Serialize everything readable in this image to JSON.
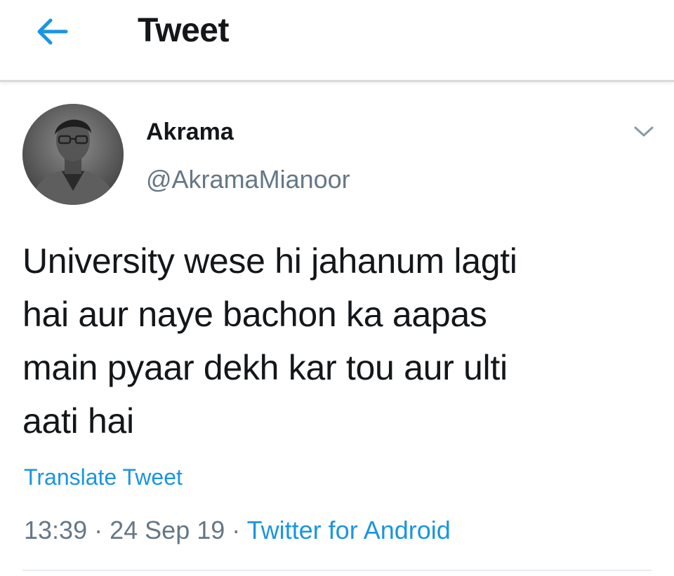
{
  "header": {
    "back_icon": "arrow-left-icon",
    "title": "Tweet"
  },
  "tweet": {
    "author": {
      "display_name": "Akrama",
      "username": "@AkramaMianoor",
      "avatar_icon": "avatar-photo"
    },
    "menu_icon": "chevron-down-icon",
    "text": "University wese hi jahanum lagti\nhai aur naye bachon ka aapas\nmain pyaar dekh kar tou aur ulti\naati hai",
    "translate_label": "Translate Tweet",
    "time": "13:39",
    "separator": "·",
    "date": "24 Sep 19",
    "source": "Twitter for Android"
  },
  "colors": {
    "accent": "#1b95e0",
    "text_primary": "#14171a",
    "text_secondary": "#657786",
    "divider": "#d7dadd"
  }
}
